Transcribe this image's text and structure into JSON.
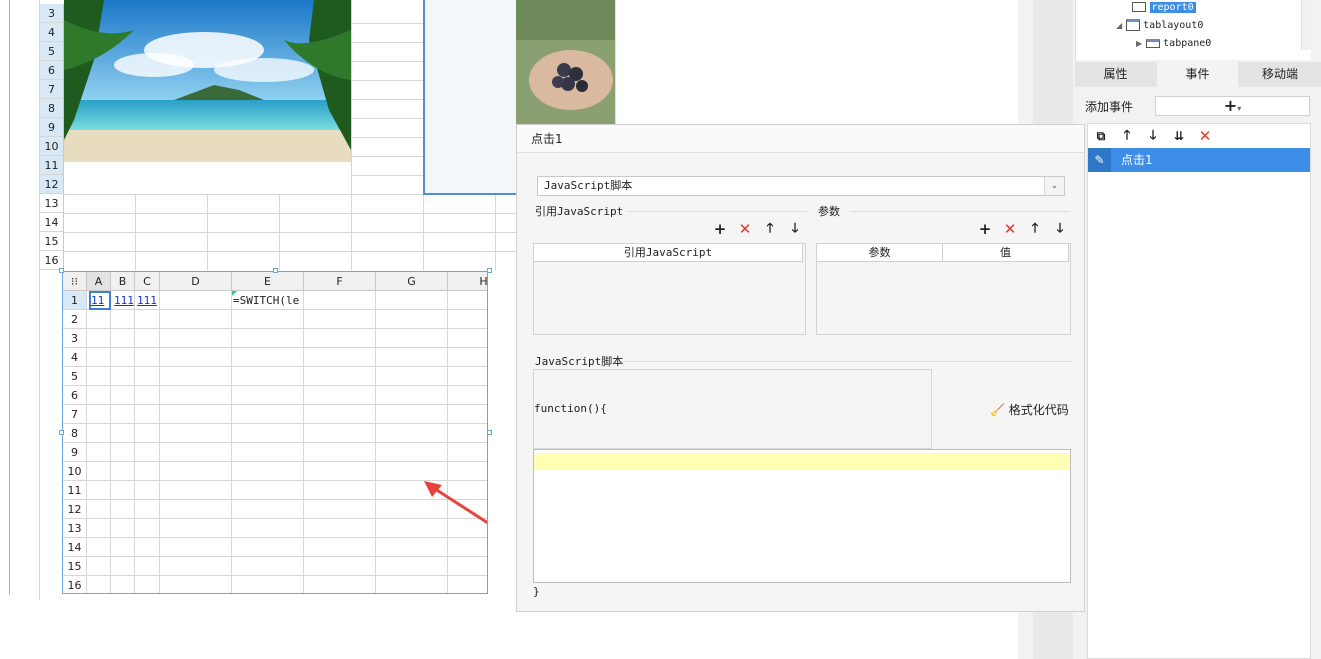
{
  "top_sheet": {
    "row_numbers": [
      "3",
      "4",
      "5",
      "6",
      "7",
      "8",
      "9",
      "10",
      "11",
      "12",
      "13",
      "14",
      "15",
      "16"
    ],
    "images": [
      "beach-palm-image",
      "berries-in-hand-image"
    ]
  },
  "sub_sheet": {
    "columns": [
      "A",
      "B",
      "C",
      "D",
      "E",
      "F",
      "G",
      "H"
    ],
    "row_numbers": [
      "1",
      "2",
      "3",
      "4",
      "5",
      "6",
      "7",
      "8",
      "9",
      "10",
      "11",
      "12",
      "13",
      "14",
      "15",
      "16"
    ],
    "cells": {
      "A1": "11",
      "B1": "111",
      "C1": "111",
      "E1": "=SWITCH(le"
    }
  },
  "dialog": {
    "title": "点击1",
    "type_select": "JavaScript脚本",
    "ref_js_section": "引用JavaScript",
    "ref_js_column": "引用JavaScript",
    "params_section": "参数",
    "params_columns": [
      "参数",
      "值"
    ],
    "script_section": "JavaScript脚本",
    "function_open": "function(){",
    "function_close": "}",
    "format_code": "格式化代码"
  },
  "right_panel": {
    "tree": [
      {
        "label": "report0",
        "selected": true
      },
      {
        "label": "tablayout0",
        "selected": false
      },
      {
        "label": "tabpane0",
        "selected": false
      }
    ],
    "tabs": [
      "属性",
      "事件",
      "移动端"
    ],
    "active_tab": "事件",
    "add_event_label": "添加事件",
    "events": [
      "点击1"
    ]
  },
  "colors": {
    "selection_blue": "#3d8ee6",
    "delete_red": "#e03a2c",
    "editor_highlight": "#ffffb3",
    "arrow_red": "#e8423a"
  }
}
